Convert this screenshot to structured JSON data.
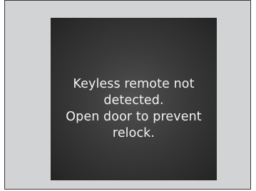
{
  "display": {
    "message_lines": [
      "Keyless remote not",
      "detected.",
      "Open door to prevent",
      "relock."
    ]
  }
}
